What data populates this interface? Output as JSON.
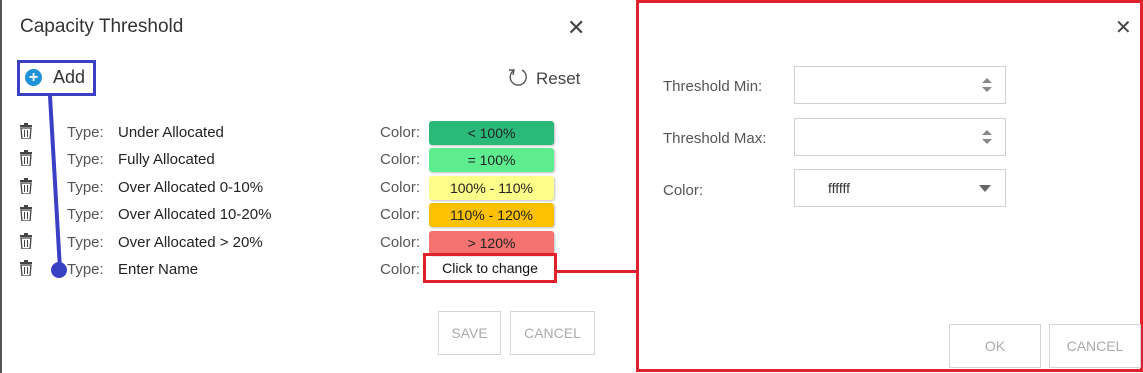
{
  "left_dialog": {
    "title": "Capacity Threshold",
    "add_label": "Add",
    "reset_label": "Reset",
    "type_prefix": "Type:",
    "color_prefix": "Color:",
    "rows": [
      {
        "type": "Under Allocated",
        "color_text": "< 100%",
        "color": "#2bb97a"
      },
      {
        "type": "Fully Allocated",
        "color_text": "= 100%",
        "color": "#5ded8f"
      },
      {
        "type": "Over Allocated 0-10%",
        "color_text": "100% - 110%",
        "color": "#fdfd8a"
      },
      {
        "type": "Over Allocated 10-20%",
        "color_text": "110% - 120%",
        "color": "#fbc102"
      },
      {
        "type": "Over Allocated > 20%",
        "color_text": "> 120%",
        "color": "#f4726f"
      }
    ],
    "new_row": {
      "type": "Enter Name",
      "color_text": "Click to change"
    },
    "save_label": "SAVE",
    "cancel_label": "CANCEL"
  },
  "right_dialog": {
    "threshold_min_label": "Threshold Min:",
    "threshold_min_value": "",
    "threshold_max_label": "Threshold Max:",
    "threshold_max_value": "",
    "color_label": "Color:",
    "color_value": "ffffff",
    "ok_label": "OK",
    "cancel_label": "CANCEL"
  },
  "colors": {
    "highlight_blue": "#3a40c4",
    "highlight_red": "#e0202a",
    "add_icon_blue": "#1f93d8"
  },
  "icons": {
    "close": "close-icon",
    "add": "plus-circle-icon",
    "reset": "reset-icon",
    "delete": "trash-icon",
    "spinner": "spinner-arrows-icon",
    "dropdown": "chevron-down-icon"
  }
}
